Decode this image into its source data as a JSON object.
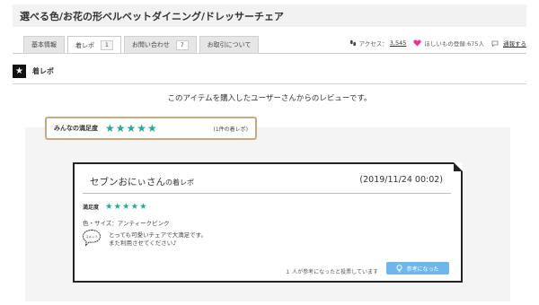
{
  "page": {
    "title": "選べる色/お花の形ベルベットダイニング/ドレッサーチェア"
  },
  "tabs": [
    {
      "label": "基本情報",
      "count": ""
    },
    {
      "label": "着レポ",
      "count": "1"
    },
    {
      "label": "お問い合わせ",
      "count": "7"
    },
    {
      "label": "お取引について",
      "count": ""
    }
  ],
  "stats": {
    "access_label": "アクセス：",
    "access_count": "3,545",
    "wish_label": "ほしいもの登録:675人",
    "share_label": "通報する"
  },
  "section": {
    "title": "着レポ",
    "intro": "このアイテムを購入したユーザーさんからのレビューです。"
  },
  "overall": {
    "label": "みんなの満足度",
    "stars": "★★★★★",
    "rating": 5,
    "count_text": "(1件の着レポ)"
  },
  "review": {
    "reviewer": "セブンおにぃさん",
    "reviewer_suffix": "の着レポ",
    "date": "(2019/11/24 00:02)",
    "satisfaction_label": "満足度",
    "stars": "★★★★★",
    "rating": 5,
    "attribute": "色・サイズ：アンティークピンク",
    "comment_icon_label": "コメント",
    "comment_line1": "とっても可愛いチェアで大満足です。",
    "comment_line2": "また利用させてください♪",
    "helpful_text": "１ 人が参考になったと投票しています",
    "helpful_button": "参考になった"
  },
  "colors": {
    "star": "#2aa79a",
    "gold_border": "#c3ac80",
    "helpful_button": "#6fb7ea",
    "heart": "#e8368f"
  }
}
